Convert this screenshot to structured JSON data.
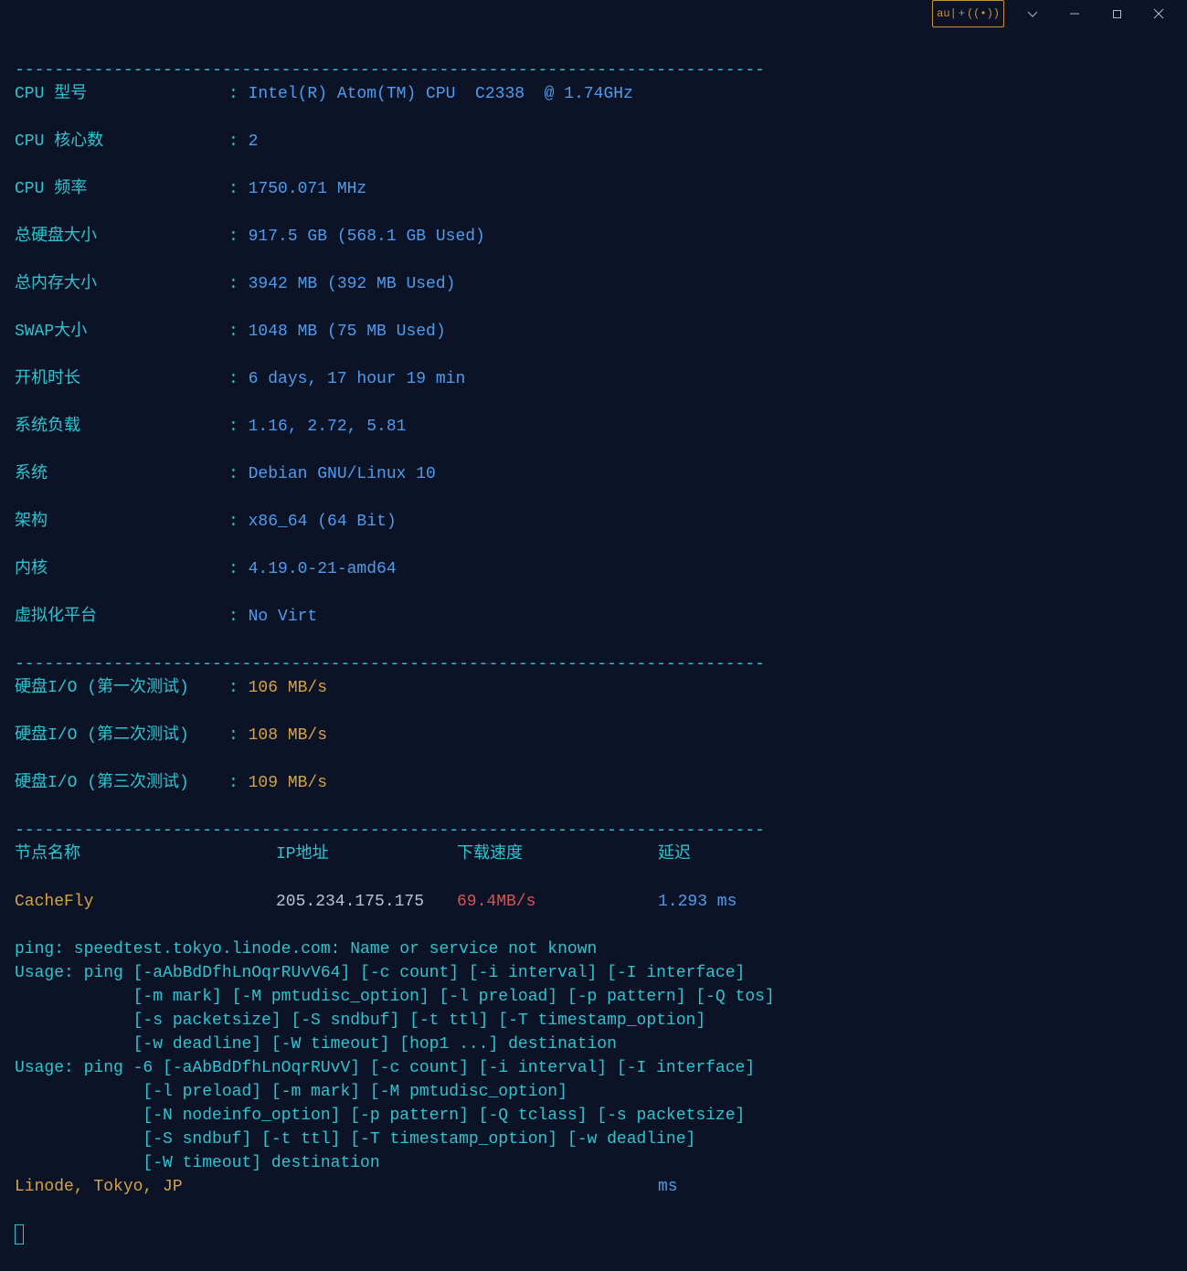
{
  "titlebar": {
    "badge_left": "au|",
    "badge_right": "((•))"
  },
  "divider": "----------------------------------------------------------------------------",
  "sysinfo": [
    {
      "label": "CPU 型号",
      "value": "Intel(R) Atom(TM) CPU  C2338  @ 1.74GHz"
    },
    {
      "label": "CPU 核心数",
      "value": "2"
    },
    {
      "label": "CPU 频率",
      "value": "1750.071 MHz"
    },
    {
      "label": "总硬盘大小",
      "value": "917.5 GB (568.1 GB Used)"
    },
    {
      "label": "总内存大小",
      "value": "3942 MB (392 MB Used)"
    },
    {
      "label": "SWAP大小",
      "value": "1048 MB (75 MB Used)"
    },
    {
      "label": "开机时长",
      "value": "6 days, 17 hour 19 min"
    },
    {
      "label": "系统负载",
      "value": "1.16, 2.72, 5.81"
    },
    {
      "label": "系统",
      "value": "Debian GNU/Linux 10"
    },
    {
      "label": "架构",
      "value": "x86_64 (64 Bit)"
    },
    {
      "label": "内核",
      "value": "4.19.0-21-amd64"
    },
    {
      "label": "虚拟化平台",
      "value": "No Virt"
    }
  ],
  "io": [
    {
      "label": "硬盘I/O (第一次测试)",
      "value": "106 MB/s"
    },
    {
      "label": "硬盘I/O (第二次测试)",
      "value": "108 MB/s"
    },
    {
      "label": "硬盘I/O (第三次测试)",
      "value": "109 MB/s"
    }
  ],
  "speed_header": {
    "node": "节点名称",
    "ip": "IP地址",
    "speed": "下载速度",
    "lat": "延迟"
  },
  "speed_rows": [
    {
      "node": "CacheFly",
      "ip": "205.234.175.175",
      "speed": "69.4MB/s",
      "lat": "1.293 ms"
    }
  ],
  "msgs": {
    "err": "ping: speedtest.tokyo.linode.com: Name or service not known",
    "u1": "Usage: ping [-aAbBdDfhLnOqrRUvV64] [-c count] [-i interval] [-I interface]",
    "u2": "            [-m mark] [-M pmtudisc_option] [-l preload] [-p pattern] [-Q tos]",
    "u3": "            [-s packetsize] [-S sndbuf] [-t ttl] [-T timestamp_option]",
    "u4": "            [-w deadline] [-W timeout] [hop1 ...] destination",
    "u5": "Usage: ping -6 [-aAbBdDfhLnOqrRUvV] [-c count] [-i interval] [-I interface]",
    "u6": "             [-l preload] [-m mark] [-M pmtudisc_option]",
    "u7": "             [-N nodeinfo_option] [-p pattern] [-Q tclass] [-s packetsize]",
    "u8": "             [-S sndbuf] [-t ttl] [-T timestamp_option] [-w deadline]",
    "u9": "             [-W timeout] destination"
  },
  "pending": {
    "node": "Linode, Tokyo, JP",
    "lat": "ms"
  }
}
